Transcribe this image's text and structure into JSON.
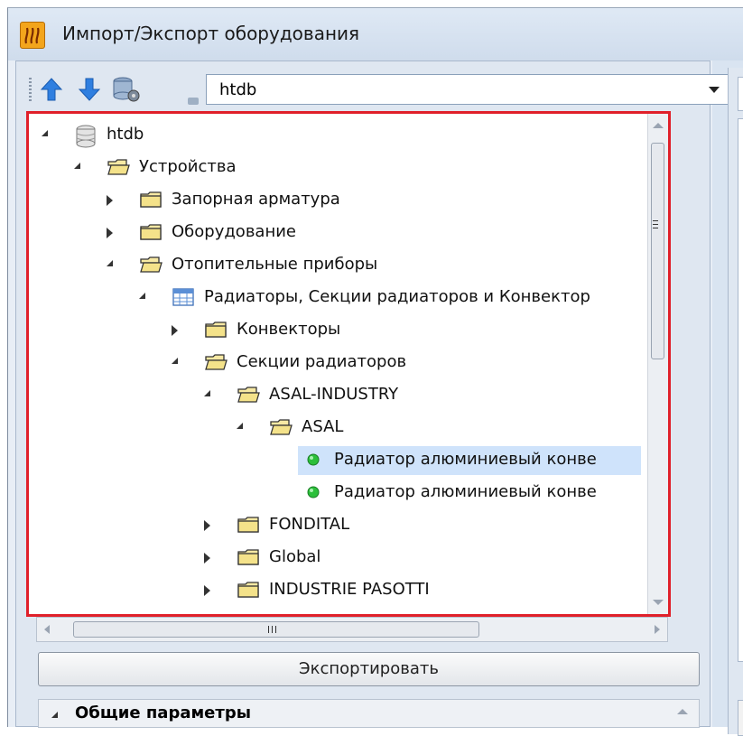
{
  "window": {
    "title": "Импорт/Экспорт оборудования"
  },
  "toolbar": {
    "database_select_value": "htdb",
    "icons": [
      "arrow-up-icon",
      "arrow-down-icon",
      "database-settings-icon"
    ]
  },
  "tree": {
    "items": [
      {
        "label": "htdb",
        "icon": "database-icon",
        "state": "expanded"
      },
      {
        "label": "Устройства",
        "icon": "folder-open-icon",
        "state": "expanded"
      },
      {
        "label": "Запорная арматура",
        "icon": "folder-icon",
        "state": "collapsed"
      },
      {
        "label": "Оборудование",
        "icon": "folder-icon",
        "state": "collapsed"
      },
      {
        "label": "Отопительные приборы",
        "icon": "folder-open-icon",
        "state": "expanded"
      },
      {
        "label": "Радиаторы, Секции радиаторов и Конвектор",
        "icon": "table-icon",
        "state": "expanded"
      },
      {
        "label": "Конвекторы",
        "icon": "folder-icon",
        "state": "collapsed"
      },
      {
        "label": "Секции радиаторов",
        "icon": "folder-open-icon",
        "state": "expanded"
      },
      {
        "label": "ASAL-INDUSTRY",
        "icon": "folder-open-icon",
        "state": "expanded"
      },
      {
        "label": "ASAL",
        "icon": "folder-open-icon",
        "state": "expanded"
      },
      {
        "label": "Радиатор алюминиевый конве",
        "icon": "green-dot-icon",
        "state": "leaf",
        "selected": true
      },
      {
        "label": "Радиатор алюминиевый конве",
        "icon": "green-dot-icon",
        "state": "leaf"
      },
      {
        "label": "FONDITAL",
        "icon": "folder-icon",
        "state": "collapsed"
      },
      {
        "label": "Global",
        "icon": "folder-icon",
        "state": "collapsed"
      },
      {
        "label": "INDUSTRIE PASOTTI",
        "icon": "folder-icon",
        "state": "collapsed"
      }
    ]
  },
  "buttons": {
    "export_label": "Экспортировать"
  },
  "sections": {
    "general_params_label": "Общие параметры"
  },
  "colors": {
    "highlight_border": "#e0202a",
    "selection": "#cfe3fb",
    "window_bg": "#d9e4f1"
  }
}
